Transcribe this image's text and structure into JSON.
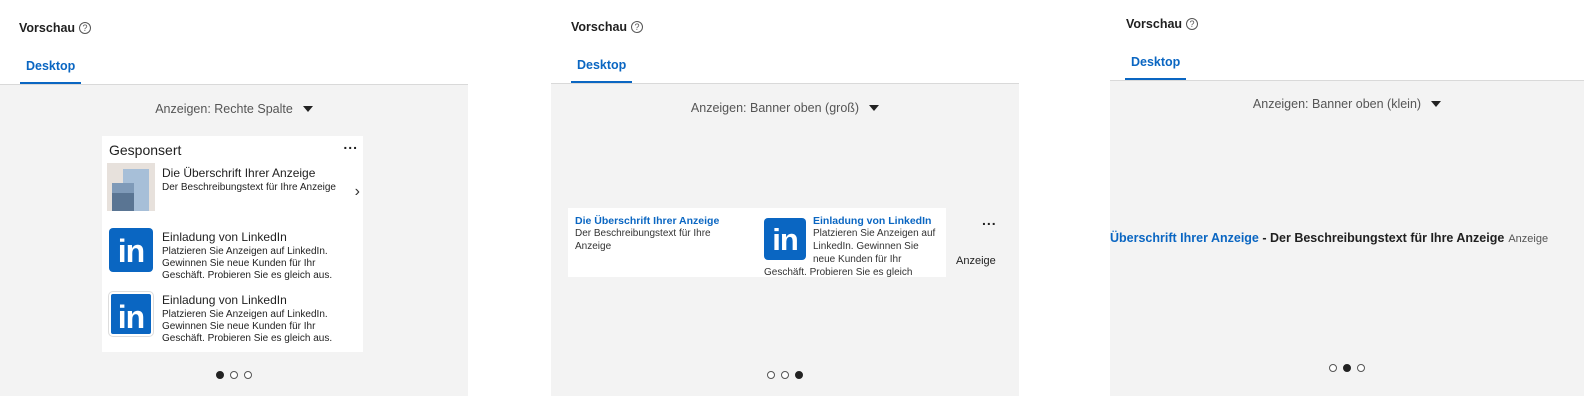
{
  "panels": [
    {
      "title": "Vorschau",
      "tab": "Desktop",
      "selector": "Anzeigen: Rechte Spalte",
      "card": {
        "sponsored": "Gesponsert",
        "more": "...",
        "headline": "Die Überschrift Ihrer Anzeige",
        "description": "Der Beschreibungstext für Ihre Anzeige",
        "items": [
          {
            "title": "Einladung von LinkedIn",
            "text": "Platzieren Sie Anzeigen auf LinkedIn. Gewinnen Sie neue Kunden für Ihr Geschäft. Probieren Sie es gleich aus."
          },
          {
            "title": "Einladung von LinkedIn",
            "text": "Platzieren Sie Anzeigen auf LinkedIn. Gewinnen Sie neue Kunden für Ihr Geschäft. Probieren Sie es gleich aus."
          }
        ]
      },
      "active_dot": 0
    },
    {
      "title": "Vorschau",
      "tab": "Desktop",
      "selector": "Anzeigen: Banner oben (groß)",
      "banner": {
        "headline": "Die Überschrift Ihrer Anzeige",
        "description": "Der Beschreibungstext für Ihre Anzeige",
        "invite_title": "Einladung von LinkedIn",
        "invite_text": "Platzieren Sie Anzeigen auf LinkedIn. Gewinnen Sie neue Kunden für Ihr",
        "invite_text_cont": "Geschäft. Probieren Sie es gleich",
        "more": "...",
        "label": "Anzeige"
      },
      "active_dot": 2
    },
    {
      "title": "Vorschau",
      "tab": "Desktop",
      "selector": "Anzeigen: Banner oben (klein)",
      "small_banner": {
        "headline": "Überschrift Ihrer Anzeige",
        "dash": " - ",
        "description": "Der Beschreibungstext für Ihre Anzeige",
        "label": "Anzeige"
      },
      "active_dot": 1
    }
  ],
  "icons": {
    "help": "?",
    "linkedin": "in",
    "next": "›"
  },
  "colors": {
    "accent": "#0a66c2",
    "stage": "#f3f3f3"
  }
}
